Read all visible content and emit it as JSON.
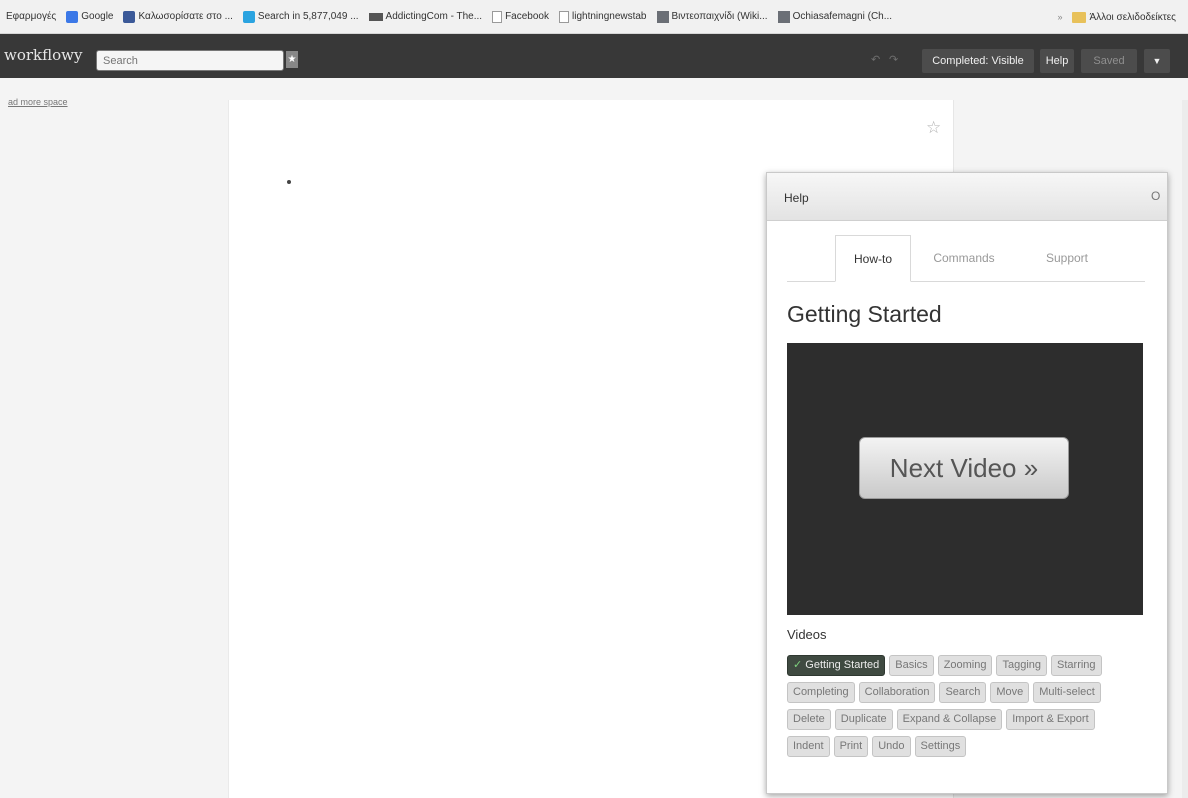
{
  "bookmarks": {
    "items": [
      {
        "label": "Εφαρμογές",
        "icon": "apps-icon"
      },
      {
        "label": "Google",
        "icon": "google-icon"
      },
      {
        "label": "Καλωσορίσατε στο ...",
        "icon": "facebook-icon"
      },
      {
        "label": "Search in 5,877,049 ...",
        "icon": "search-site-icon"
      },
      {
        "label": "AddictingCom - The...",
        "icon": "addicting-icon"
      },
      {
        "label": "Facebook",
        "icon": "page-icon"
      },
      {
        "label": "lightningnewstab",
        "icon": "page-icon"
      },
      {
        "label": "Βιντεοπαιχνίδι (Wiki...",
        "icon": "wiki-icon"
      },
      {
        "label": "Ochiasafemagni (Ch...",
        "icon": "wiki-icon"
      }
    ],
    "overflow_arrow": "»",
    "other_bookmarks": "Άλλοι σελιδοδείκτες"
  },
  "header": {
    "logo": "workflowy",
    "search_placeholder": "Search",
    "star": "★",
    "undo": "↶",
    "redo": "↷",
    "completed_visible": "Completed: Visible",
    "help": "Help",
    "saved": "Saved",
    "menu_arrow": "▼"
  },
  "page": {
    "more_space": "ad more space",
    "star_outline": "☆"
  },
  "help_panel": {
    "title": "Help",
    "close": "O",
    "tabs": [
      "How-to",
      "Commands",
      "Support"
    ],
    "section_title": "Getting Started",
    "next_video": "Next Video »",
    "videos_label": "Videos",
    "video_rows": [
      [
        "Getting Started",
        "Basics",
        "Zooming",
        "Tagging",
        "Starring"
      ],
      [
        "Completing",
        "Collaboration",
        "Search",
        "Move",
        "Multi-select"
      ],
      [
        "Delete",
        "Duplicate",
        "Expand & Collapse",
        "Import & Export"
      ],
      [
        "Indent",
        "Print",
        "Undo",
        "Settings"
      ]
    ],
    "check": "✓"
  }
}
